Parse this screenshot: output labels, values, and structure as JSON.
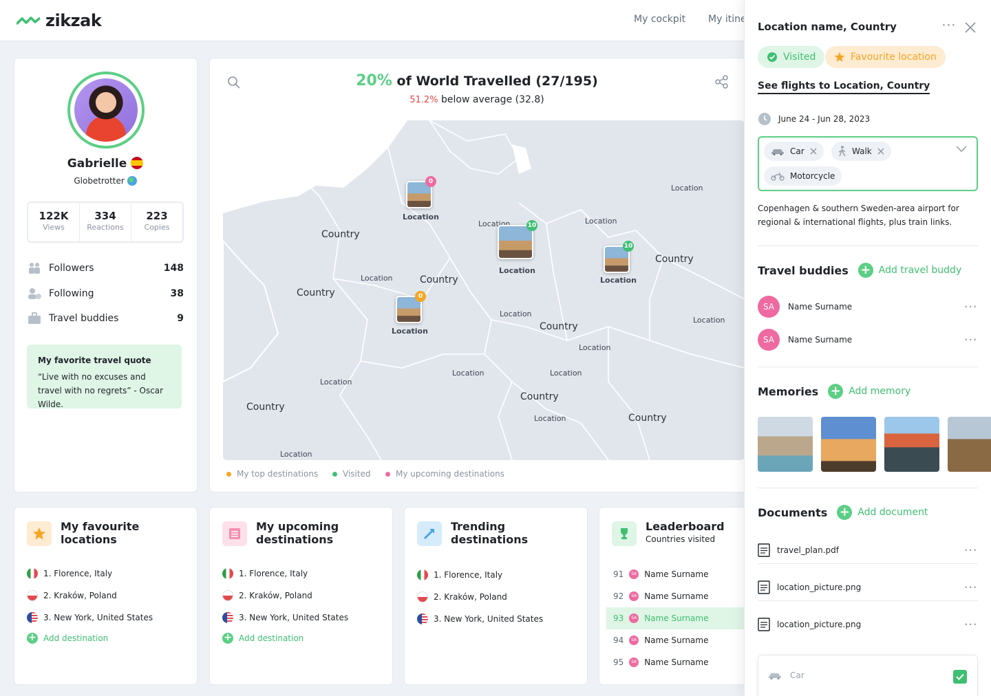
{
  "brand": {
    "name": "zikzak",
    "color": "#3fbf72"
  },
  "nav": {
    "items": [
      "My cockpit",
      "My itine"
    ]
  },
  "profile": {
    "name": "Gabrielle",
    "subtitle": "Globetrotter",
    "stats": [
      {
        "value": "122K",
        "label": "Views"
      },
      {
        "value": "334",
        "label": "Reactions"
      },
      {
        "value": "223",
        "label": "Copies"
      }
    ],
    "rows": [
      {
        "label": "Followers",
        "value": "148"
      },
      {
        "label": "Following",
        "value": "38"
      },
      {
        "label": "Travel buddies",
        "value": "9"
      }
    ],
    "quote_title": "My favorite travel quote",
    "quote_text": "“Live with no excuses and travel with no regrets” - Oscar Wilde."
  },
  "map": {
    "percent": "20%",
    "title": "of World Travelled (27/195)",
    "below_pct": "51.2%",
    "below_text": "below average (32.8)",
    "labels": {
      "country": "Country",
      "location": "Location"
    },
    "pins": [
      {
        "badge": "0",
        "label": "Location"
      },
      {
        "badge": "10",
        "label": "Location"
      },
      {
        "badge": "10",
        "label": "Location"
      },
      {
        "badge": "0",
        "label": "Location"
      }
    ],
    "legend": [
      "My top destinations",
      "Visited",
      "My upcoming destinations"
    ],
    "colors": {
      "top": "#f5a623",
      "visited": "#3fbf72",
      "upcoming": "#ef6aa0"
    }
  },
  "favourites": {
    "title_l1": "My favourite",
    "title_l2": "locations",
    "items": [
      "1.  Florence, Italy",
      "2. Kraków, Poland",
      "3. New York, United States"
    ],
    "add": "Add destination"
  },
  "upcoming": {
    "title_l1": "My upcoming",
    "title_l2": "destinations",
    "items": [
      "1.  Florence, Italy",
      "2. Kraków, Poland",
      "3. New York, United States"
    ],
    "add": "Add destination"
  },
  "trending": {
    "title_l1": "Trending",
    "title_l2": "destinations",
    "items": [
      "1.  Florence, Italy",
      "2. Kraków, Poland",
      "3. New York, United States"
    ]
  },
  "leaderboard": {
    "title": "Leaderboard",
    "subtitle": "Countries visited",
    "avatar_initials": "SA",
    "rows": [
      {
        "rank": "91",
        "name": "Name Surname"
      },
      {
        "rank": "92",
        "name": "Name Surname"
      },
      {
        "rank": "93",
        "name": "Name Surname"
      },
      {
        "rank": "94",
        "name": "Name Surname"
      },
      {
        "rank": "95",
        "name": "Name Surname"
      }
    ]
  },
  "panel": {
    "title": "Location name, Country",
    "visited": "Visited",
    "favourite": "Favourite location",
    "flights_link": "See flights to Location, Country",
    "dates": "June 24 - Jun 28, 2023",
    "transport": [
      "Car",
      "Walk",
      "Motorcycle"
    ],
    "description": "Copenhagen & southern Sweden-area airport for regional & international flights, plus train links.",
    "buddies_title": "Travel buddies",
    "add_buddy": "Add travel buddy",
    "buddies": [
      {
        "initials": "SA",
        "name": "Name Surname"
      },
      {
        "initials": "SA",
        "name": "Name Surname"
      }
    ],
    "memories_title": "Memories",
    "add_memory": "Add memory",
    "documents_title": "Documents",
    "add_document": "Add document",
    "documents": [
      "travel_plan.pdf",
      "location_picture.png",
      "location_picture.png"
    ],
    "bottom_option": "Car"
  }
}
